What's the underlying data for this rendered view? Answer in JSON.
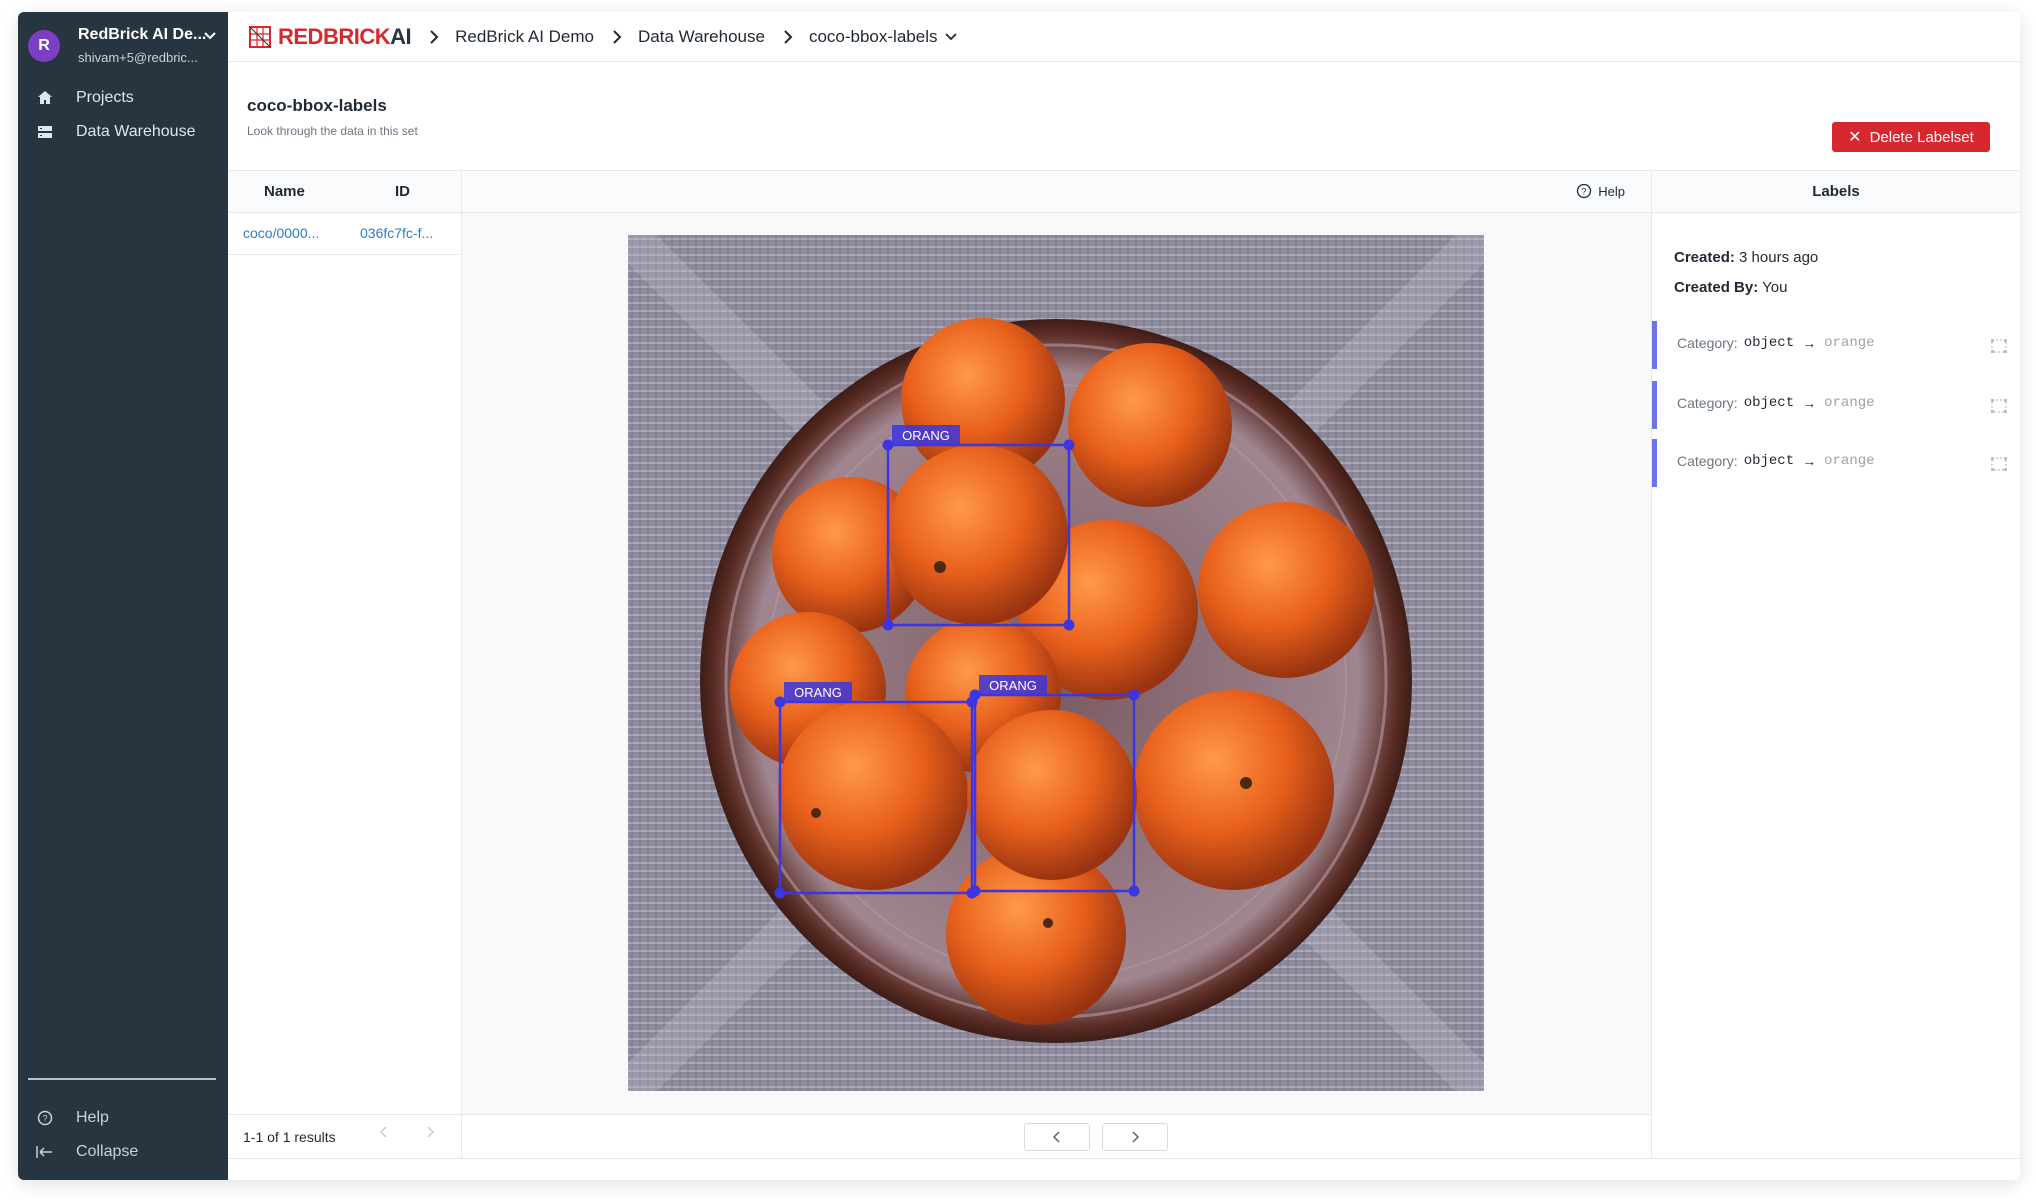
{
  "workspace": {
    "initial": "R",
    "name": "RedBrick AI De...",
    "email": "shivam+5@redbric..."
  },
  "sidebar": {
    "items": [
      {
        "label": "Projects",
        "icon": "home-icon"
      },
      {
        "label": "Data Warehouse",
        "icon": "database-icon"
      }
    ],
    "bottom": [
      {
        "label": "Help",
        "icon": "help-circle-icon"
      },
      {
        "label": "Collapse",
        "icon": "collapse-icon"
      }
    ]
  },
  "brand": {
    "part1": "REDBRICK",
    "part2": "AI",
    "red": "#d7282f",
    "dark": "#263540"
  },
  "breadcrumb": [
    "RedBrick AI Demo",
    "Data Warehouse",
    "coco-bbox-labels"
  ],
  "header": {
    "title": "coco-bbox-labels",
    "subtitle": "Look through the data in this set",
    "delete_label": "Delete Labelset"
  },
  "table": {
    "columns": [
      "Name",
      "ID"
    ],
    "rows": [
      {
        "name": "coco/0000...",
        "id": "036fc7fc-f..."
      }
    ],
    "results": "1-1 of 1 results"
  },
  "viewer": {
    "help_label": "Help",
    "boxes": [
      {
        "label": "ORANG"
      },
      {
        "label": "ORANG"
      },
      {
        "label": "ORANG"
      }
    ],
    "box_color": "#3b36e0"
  },
  "labels_panel": {
    "title": "Labels",
    "created_key": "Created:",
    "created_value": "3 hours ago",
    "created_by_key": "Created By:",
    "created_by_value": "You",
    "items": [
      {
        "prefix": "Category:",
        "class": "object",
        "value": "orange"
      },
      {
        "prefix": "Category:",
        "class": "object",
        "value": "orange"
      },
      {
        "prefix": "Category:",
        "class": "object",
        "value": "orange"
      }
    ],
    "accent": "#6b73e8"
  }
}
